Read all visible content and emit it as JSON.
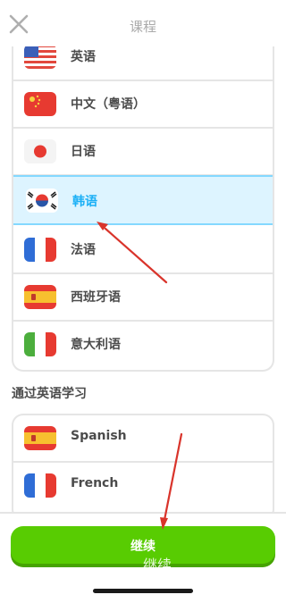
{
  "header": {
    "title": "课程",
    "close_icon": "close-icon"
  },
  "languages": [
    {
      "label": "英语",
      "flag": "us-flag-icon"
    },
    {
      "label": "中文（粤语）",
      "flag": "hk-flag-icon"
    },
    {
      "label": "日语",
      "flag": "japan-flag-icon"
    },
    {
      "label": "韩语",
      "flag": "korea-flag-icon",
      "selected": true
    },
    {
      "label": "法语",
      "flag": "france-flag-icon"
    },
    {
      "label": "西班牙语",
      "flag": "spain-flag-icon"
    },
    {
      "label": "意大利语",
      "flag": "italy-flag-icon"
    }
  ],
  "section": {
    "title": "通过英语学习"
  },
  "english_courses": [
    {
      "label": "Spanish",
      "flag": "spain-flag-icon"
    },
    {
      "label": "French",
      "flag": "france-flag-icon"
    }
  ],
  "footer": {
    "continue_label": "继续",
    "watermark": "继续"
  },
  "colors": {
    "accent_green": "#58cc02",
    "selected_blue": "#1cb0f6",
    "selected_bg": "#ddf4ff",
    "arrow_red": "#d9342b"
  }
}
